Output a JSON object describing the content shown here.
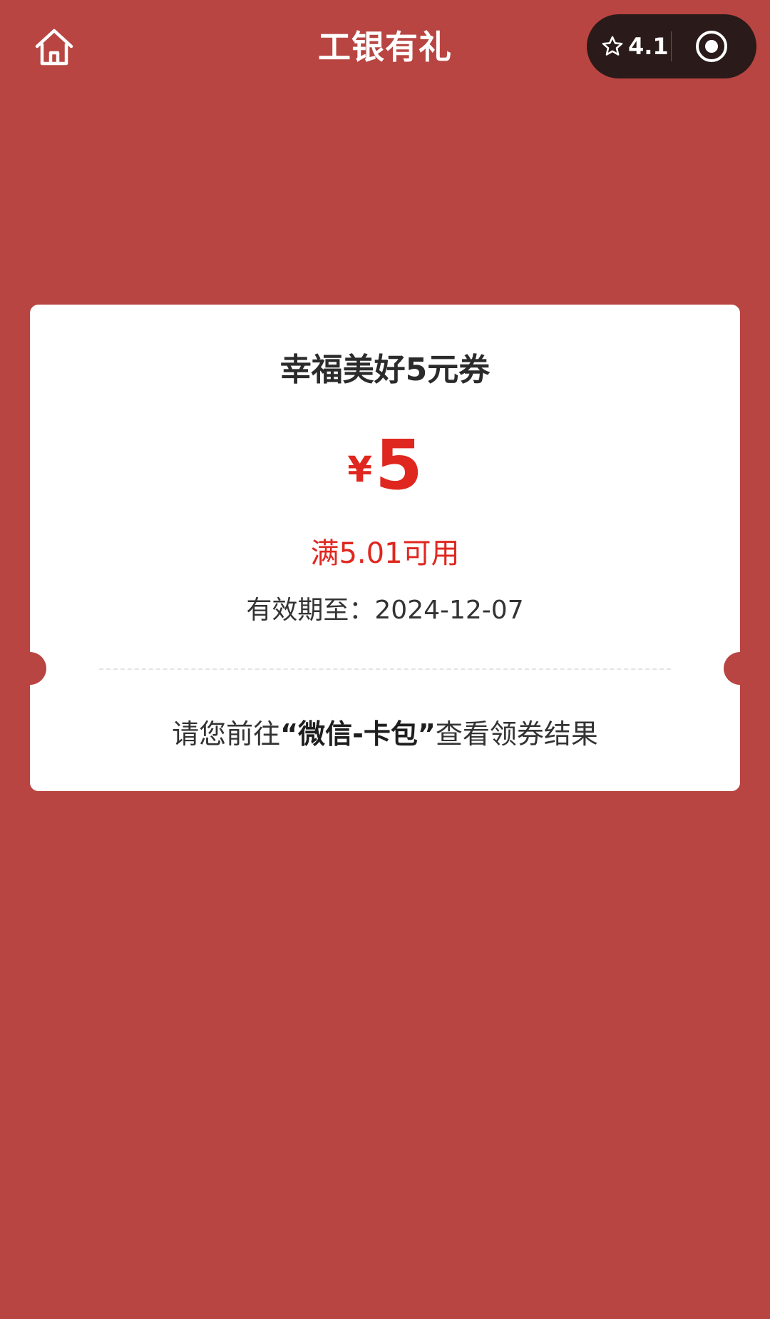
{
  "header": {
    "title": "工银有礼",
    "home_icon": "home-icon",
    "capsule": {
      "rating": "4.1",
      "star_icon": "star-outline-icon",
      "target_icon": "record-target-icon"
    }
  },
  "coupon": {
    "name": "幸福美好5元券",
    "currency_symbol": "¥",
    "amount": "5",
    "condition": "满5.01可用",
    "validity": "有效期至：2024-12-07",
    "note_prefix": "请您前往",
    "note_highlight": "“微信-卡包”",
    "note_suffix": "查看领券结果"
  },
  "colors": {
    "background": "#b84541",
    "accent_red": "#e0271f",
    "capsule_bg": "#2a1a1a",
    "card_bg": "#ffffff"
  }
}
